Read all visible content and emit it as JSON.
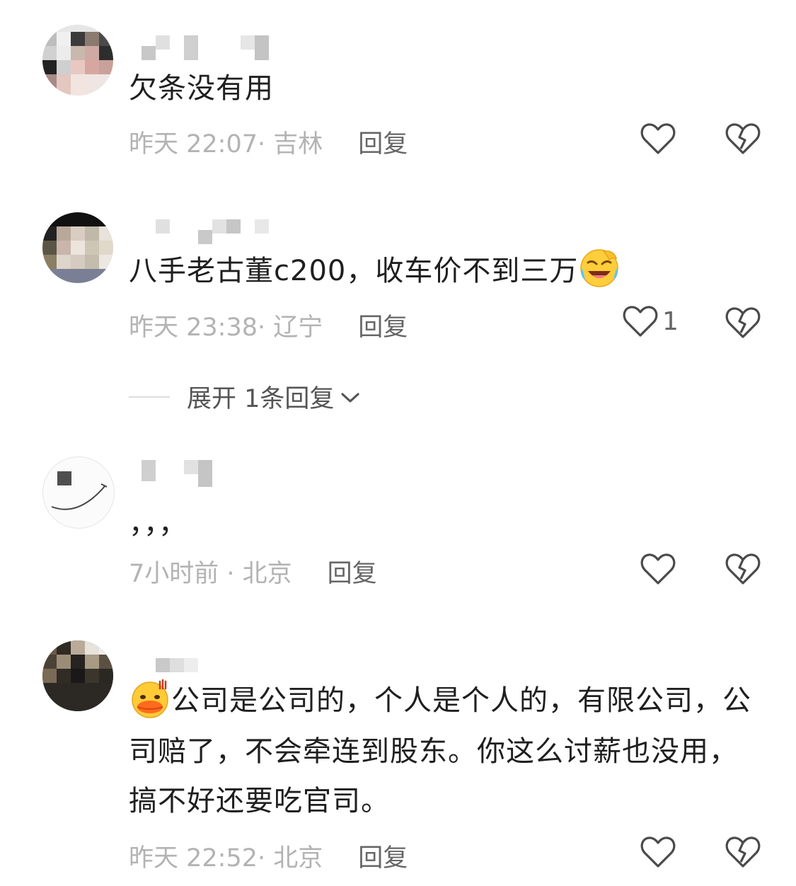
{
  "comments": [
    {
      "text": "欠条没有用",
      "time_location": "昨天 22:07· 吉林",
      "reply_label": "回复"
    },
    {
      "text": "八手老古董c200，收车价不到三万",
      "emoji": "laughing-crying-emoji",
      "time_location": "昨天 23:38· 辽宁",
      "reply_label": "回复",
      "like_count": "1",
      "expand_label": "展开 1条回复"
    },
    {
      "text": "，，，",
      "time_location": "7小时前 · 北京",
      "reply_label": "回复"
    },
    {
      "text": "公司是公司的，个人是个人的，有限公司，公司赔了，不会牵连到股东。你这么讨薪也没用，搞不好还要吃官司。",
      "emoji": "sweating-duck-emoji",
      "time_location": "昨天 22:52· 北京",
      "reply_label": "回复"
    }
  ],
  "icons": {
    "like": "heart-outline-icon",
    "dislike": "broken-heart-icon",
    "expand": "chevron-down-icon"
  },
  "colors": {
    "text": "#1f1f1f",
    "meta": "#b3b3b3",
    "reply": "#666666"
  }
}
